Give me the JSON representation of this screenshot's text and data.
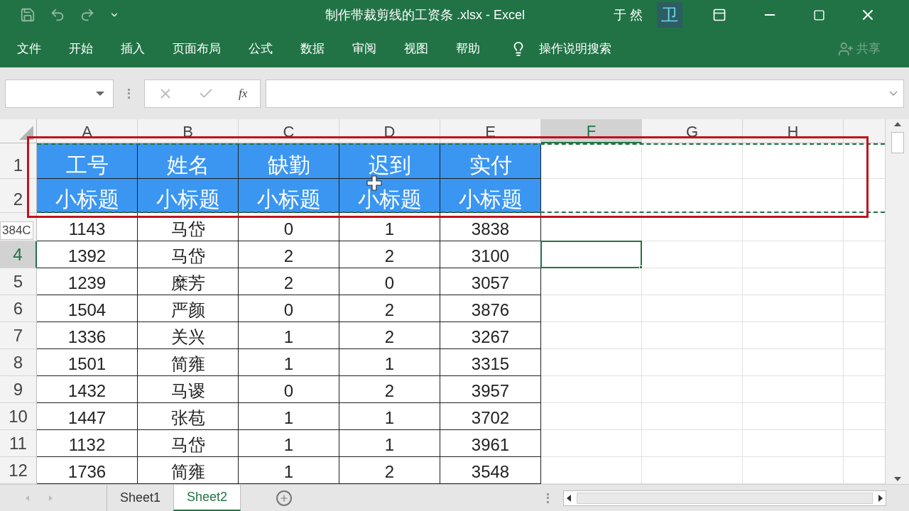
{
  "window": {
    "title": "制作带裁剪线的工资条 .xlsx  -  Excel",
    "user": "于 然",
    "avatar": "卫"
  },
  "ribbon": {
    "tabs": [
      {
        "label": "文件"
      },
      {
        "label": "开始"
      },
      {
        "label": "插入"
      },
      {
        "label": "页面布局"
      },
      {
        "label": "公式"
      },
      {
        "label": "数据"
      },
      {
        "label": "审阅"
      },
      {
        "label": "视图"
      },
      {
        "label": "帮助"
      }
    ],
    "tell_me": "操作说明搜索",
    "share": "共享"
  },
  "formula_bar": {
    "fx": "fx"
  },
  "columns": [
    {
      "label": "A",
      "selected": false
    },
    {
      "label": "B",
      "selected": false
    },
    {
      "label": "C",
      "selected": false
    },
    {
      "label": "D",
      "selected": false
    },
    {
      "label": "E",
      "selected": false
    },
    {
      "label": "F",
      "selected": true
    },
    {
      "label": "G",
      "selected": false
    },
    {
      "label": "H",
      "selected": false
    }
  ],
  "rows": [
    {
      "header": "1",
      "kind": "title",
      "selected": false,
      "copied": true,
      "cells": [
        "工号",
        "姓名",
        "缺勤",
        "迟到",
        "实付"
      ]
    },
    {
      "header": "2",
      "kind": "title",
      "selected": false,
      "copied": true,
      "cells": [
        "小标题",
        "小标题",
        "小标题",
        "小标题",
        "小标题"
      ]
    },
    {
      "tooltip": "384C",
      "kind": "data",
      "selected": false,
      "copied": false,
      "cells": [
        "1143",
        "马岱",
        "0",
        "1",
        "3838"
      ]
    },
    {
      "header": "4",
      "kind": "data",
      "selected": true,
      "copied": false,
      "cells": [
        "1392",
        "马岱",
        "2",
        "2",
        "3100"
      ]
    },
    {
      "header": "5",
      "kind": "data",
      "selected": false,
      "copied": false,
      "cells": [
        "1239",
        "糜芳",
        "2",
        "0",
        "3057"
      ]
    },
    {
      "header": "6",
      "kind": "data",
      "selected": false,
      "copied": false,
      "cells": [
        "1504",
        "严颜",
        "0",
        "2",
        "3876"
      ]
    },
    {
      "header": "7",
      "kind": "data",
      "selected": false,
      "copied": false,
      "cells": [
        "1336",
        "关兴",
        "1",
        "2",
        "3267"
      ]
    },
    {
      "header": "8",
      "kind": "data",
      "selected": false,
      "copied": false,
      "cells": [
        "1501",
        "简雍",
        "1",
        "1",
        "3315"
      ]
    },
    {
      "header": "9",
      "kind": "data",
      "selected": false,
      "copied": false,
      "cells": [
        "1432",
        "马谡",
        "0",
        "2",
        "3957"
      ]
    },
    {
      "header": "10",
      "kind": "data",
      "selected": false,
      "copied": false,
      "cells": [
        "1447",
        "张苞",
        "1",
        "1",
        "3702"
      ]
    },
    {
      "header": "11",
      "kind": "data",
      "selected": false,
      "copied": false,
      "cells": [
        "1132",
        "马岱",
        "1",
        "1",
        "3961"
      ]
    },
    {
      "header": "12",
      "kind": "data",
      "selected": false,
      "copied": false,
      "cells": [
        "1736",
        "简雍",
        "1",
        "2",
        "3548"
      ]
    }
  ],
  "sheets": [
    {
      "label": "Sheet1",
      "selected": false
    },
    {
      "label": "Sheet2",
      "selected": true
    }
  ]
}
